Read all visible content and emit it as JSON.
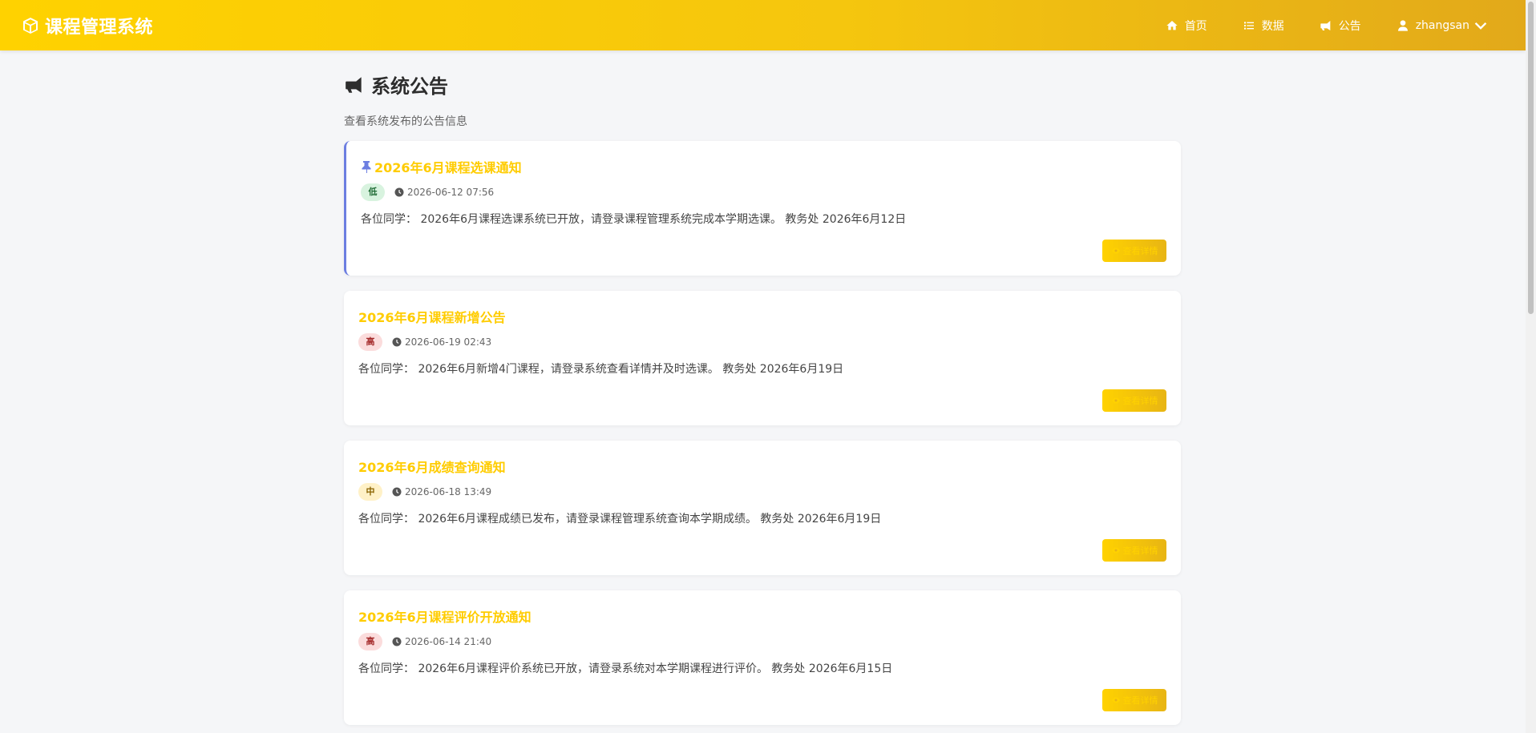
{
  "navbar": {
    "brand": "课程管理系统",
    "links": {
      "home": "首页",
      "data": "数据",
      "notice": "公告"
    },
    "user": "zhangsan"
  },
  "page": {
    "title": "系统公告",
    "subtitle": "查看系统发布的公告信息"
  },
  "announcements": [
    {
      "title": "2026年6月课程选课通知",
      "priority": "低",
      "time": "2026-06-12 07:56",
      "content": "各位同学： 2026年6月课程选课系统已开放，请登录课程管理系统完成本学期选课。 教务处 2026年6月12日",
      "button": "查看详情",
      "pinned": true
    },
    {
      "title": "2026年6月课程新增公告",
      "priority": "高",
      "time": "2026-06-19 02:43",
      "content": "各位同学： 2026年6月新增4门课程，请登录系统查看详情并及时选课。 教务处 2026年6月19日",
      "button": "查看详情"
    },
    {
      "title": "2026年6月成绩查询通知",
      "priority": "中",
      "time": "2026-06-18 13:49",
      "content": "各位同学： 2026年6月课程成绩已发布，请登录课程管理系统查询本学期成绩。 教务处 2026年6月19日",
      "button": "查看详情"
    },
    {
      "title": "2026年6月课程评价开放通知",
      "priority": "高",
      "time": "2026-06-14 21:40",
      "content": "各位同学： 2026年6月课程评价系统已开放，请登录系统对本学期课程进行评价。 教务处 2026年6月15日",
      "button": "查看详情"
    }
  ],
  "icons": [
    "cube-icon",
    "home-icon",
    "list-icon",
    "bullhorn-icon",
    "user-icon",
    "chevron-down-icon",
    "pin-icon",
    "clock-icon",
    "eye-icon"
  ],
  "colors": {
    "accent": "#ffd200",
    "title": "#ffcc00",
    "pin_border": "#6c7ee1"
  }
}
